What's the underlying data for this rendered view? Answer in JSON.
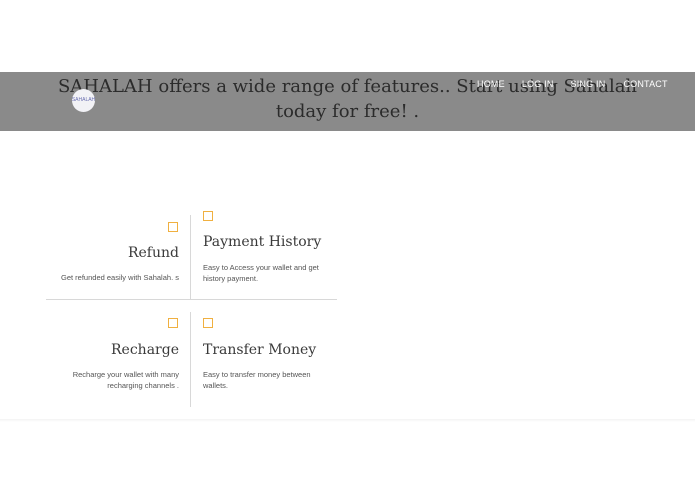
{
  "header": {
    "tagline": "SAHALAH offers a wide range of features.. Start using Sahalah today for free! .",
    "logo_text": "SAHALAH"
  },
  "nav": {
    "items": [
      "HOME",
      "LOG IN",
      "SING IN",
      "CONTACT"
    ]
  },
  "features": [
    {
      "title": "Refund",
      "desc": "Get refunded easily with Sahalah. s"
    },
    {
      "title": "Payment History",
      "desc": "Easy to Access your wallet and get history payment."
    },
    {
      "title": "Recharge",
      "desc": "Recharge your wallet with many recharging channels ."
    },
    {
      "title": "Transfer Money",
      "desc": "Easy to transfer money between wallets."
    }
  ],
  "colors": {
    "bar": "#8a8a8a",
    "accent": "#f0b040"
  }
}
